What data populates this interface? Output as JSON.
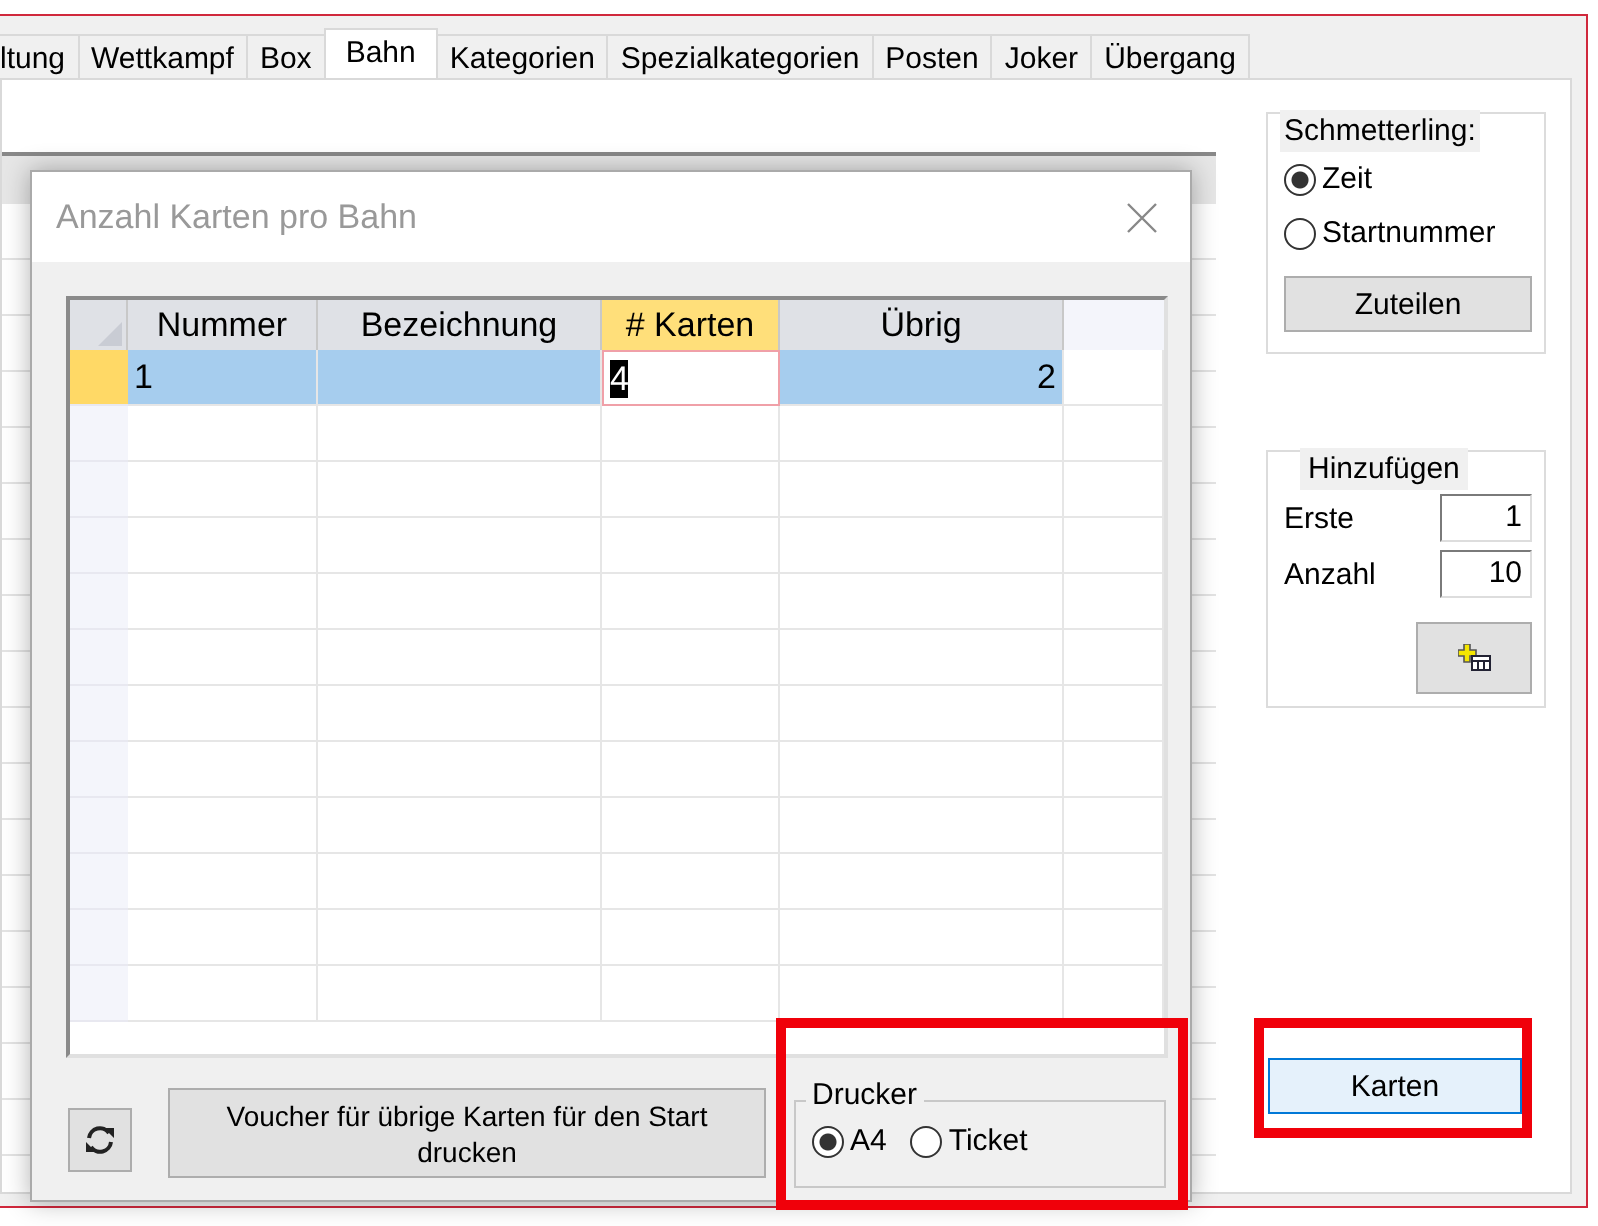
{
  "tabs": [
    {
      "label": "ltung",
      "selected": false
    },
    {
      "label": "Wettkampf",
      "selected": false
    },
    {
      "label": "Box",
      "selected": false
    },
    {
      "label": "Bahn",
      "selected": true
    },
    {
      "label": "Kategorien",
      "selected": false
    },
    {
      "label": "Spezialkategorien",
      "selected": false
    },
    {
      "label": "Posten",
      "selected": false
    },
    {
      "label": "Joker",
      "selected": false
    },
    {
      "label": "Übergang",
      "selected": false
    }
  ],
  "schmetterling": {
    "title": "Schmetterling:",
    "options": [
      {
        "label": "Zeit",
        "selected": true
      },
      {
        "label": "Startnummer",
        "selected": false
      }
    ],
    "button": "Zuteilen"
  },
  "hinzufuegen": {
    "title": "Hinzufügen",
    "fields": [
      {
        "label": "Erste",
        "value": "1"
      },
      {
        "label": "Anzahl",
        "value": "10"
      }
    ]
  },
  "karten_button": "Karten",
  "dialog": {
    "title": "Anzahl Karten pro Bahn",
    "columns": [
      {
        "label": "Nummer",
        "selected": false
      },
      {
        "label": "Bezeichnung",
        "selected": false
      },
      {
        "label": "# Karten",
        "selected": true
      },
      {
        "label": "Übrig",
        "selected": false
      }
    ],
    "rows": [
      {
        "number": "1",
        "count": "4",
        "remaining": "2",
        "selected": true
      }
    ],
    "voucher_button": "Voucher für übrige Karten für den Start drucken",
    "printer": {
      "title": "Drucker",
      "options": [
        {
          "label": "A4",
          "selected": true
        },
        {
          "label": "Ticket",
          "selected": false
        }
      ]
    }
  }
}
